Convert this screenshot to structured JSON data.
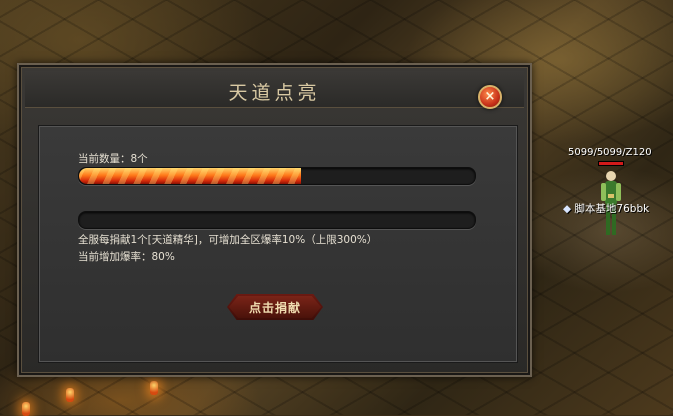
{
  "dialog": {
    "title": "天道点亮",
    "close_label": "×",
    "current_count_text": "当前数量：8个",
    "progress_fraction": 0.56,
    "second_progress_fraction": 0,
    "description_text": "全服每捐献1个[天道精华]，可增加全区爆率10%（上限300%）",
    "current_bonus_text": "当前增加爆率：80%",
    "donate_button_label": "点击捐献"
  },
  "player": {
    "stats_text": "5099/5099/Z120",
    "name_text": "脚本基地76bbk"
  },
  "colors": {
    "progress_fill": "#ff7a1a",
    "title_text": "#d9c9a3",
    "body_text": "#e6e0d2",
    "hp": "#d21a1a"
  },
  "icons": {
    "close": "close-icon",
    "player": "player-character-icon"
  }
}
